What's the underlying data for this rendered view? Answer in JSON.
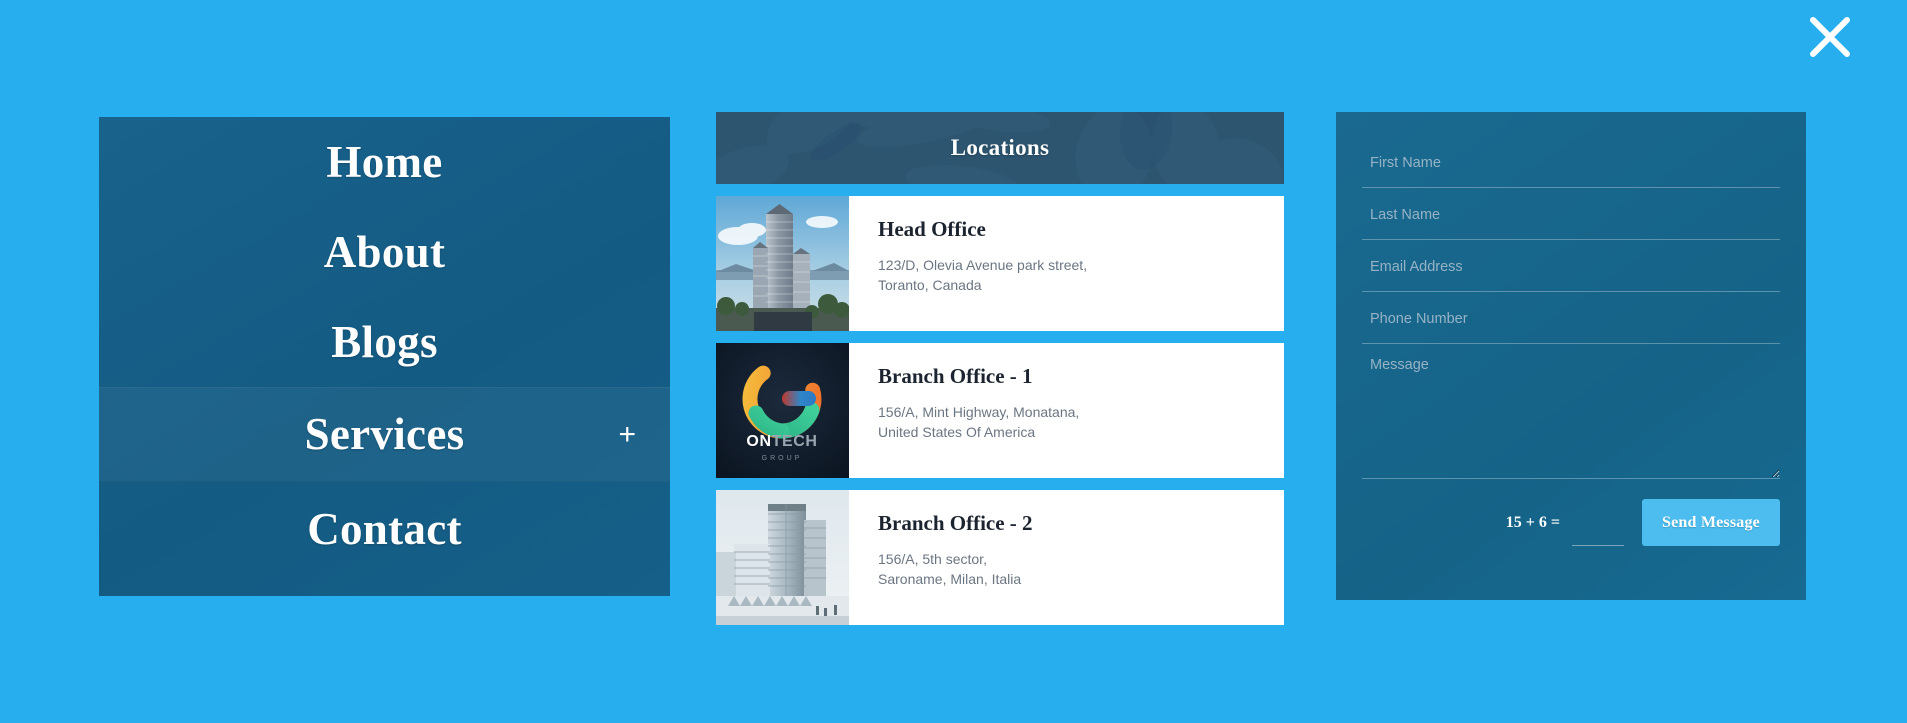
{
  "page": {
    "background_color": "#27aeee"
  },
  "close": {
    "icon": "close-icon",
    "label": "Close"
  },
  "nav": {
    "panel_color": "#16628a",
    "items": [
      {
        "label": "Home",
        "has_submenu": false,
        "hovered": false
      },
      {
        "label": "About",
        "has_submenu": false,
        "hovered": false
      },
      {
        "label": "Blogs",
        "has_submenu": false,
        "hovered": false
      },
      {
        "label": "Services",
        "has_submenu": true,
        "hovered": true,
        "submenu_toggle": "+"
      },
      {
        "label": "Contact",
        "has_submenu": false,
        "hovered": false
      }
    ]
  },
  "locations": {
    "header_title": "Locations",
    "header_color": "#2d5570",
    "cards": [
      {
        "title": "Head Office",
        "address_line1": "123/D, Olevia Avenue park street,",
        "address_line2": "Toranto, Canada",
        "thumb": "skyscraper-photo"
      },
      {
        "title": "Branch Office - 1",
        "address_line1": "156/A, Mint Highway, Monatana,",
        "address_line2": "United States Of America",
        "thumb": "ontech-group-logo",
        "logo_primary": "ONTECH",
        "logo_secondary": "GROUP"
      },
      {
        "title": "Branch Office - 2",
        "address_line1": "156/A, 5th sector,",
        "address_line2": "Saroname, Milan, Italia",
        "thumb": "office-building-photo"
      }
    ]
  },
  "form": {
    "panel_color": "#16628a",
    "fields": [
      {
        "name": "first-name",
        "placeholder": "First Name",
        "value": ""
      },
      {
        "name": "last-name",
        "placeholder": "Last Name",
        "value": ""
      },
      {
        "name": "email-address",
        "placeholder": "Email Address",
        "value": ""
      },
      {
        "name": "phone-number",
        "placeholder": "Phone Number",
        "value": ""
      }
    ],
    "message": {
      "placeholder": "Message",
      "value": ""
    },
    "captcha": {
      "question": "15 + 6 =",
      "value": "",
      "placeholder": ""
    },
    "submit_label": "Send Message",
    "submit_color": "#4cbdee"
  }
}
